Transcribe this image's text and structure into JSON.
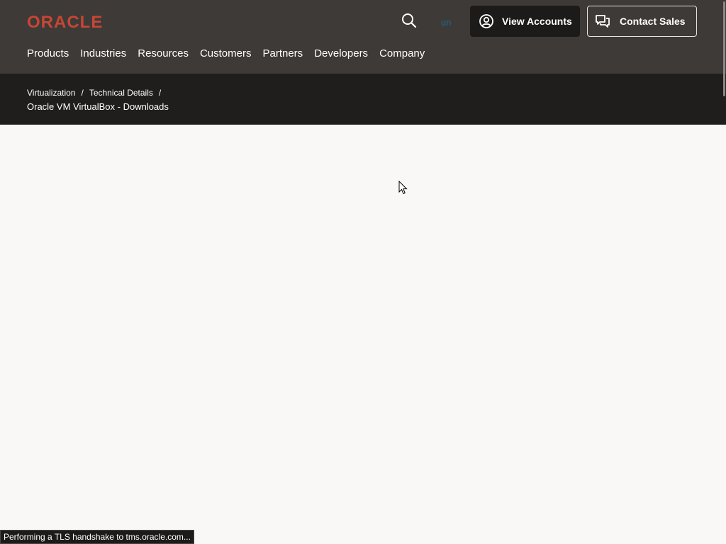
{
  "brand": {
    "logo_text": "ORACLE",
    "logo_color": "#c74634"
  },
  "header": {
    "search_icon": "search-icon",
    "lang_text": "un",
    "view_accounts_label": "View Accounts",
    "view_accounts_icon": "user-circle-icon",
    "contact_sales_label": "Contact Sales",
    "contact_sales_icon": "chat-bubbles-icon"
  },
  "nav": {
    "items": [
      {
        "label": "Products"
      },
      {
        "label": "Industries"
      },
      {
        "label": "Resources"
      },
      {
        "label": "Customers"
      },
      {
        "label": "Partners"
      },
      {
        "label": "Developers"
      },
      {
        "label": "Company"
      }
    ]
  },
  "breadcrumb": {
    "items": [
      {
        "label": "Virtualization"
      },
      {
        "label": "Technical Details"
      }
    ],
    "separator": "/",
    "current": "Oracle VM VirtualBox - Downloads"
  },
  "status_bar": {
    "text": "Performing a TLS handshake to tms.oracle.com..."
  },
  "colors": {
    "header_bg": "#3d3a37",
    "breadcrumb_bg": "#1f1e1c",
    "page_bg": "#f9f8f6",
    "accent": "#c74634"
  }
}
